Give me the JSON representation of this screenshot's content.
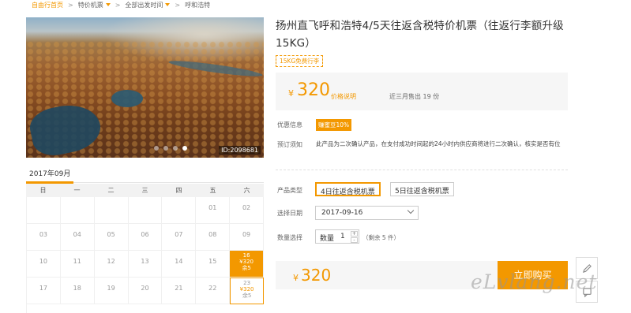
{
  "breadcrumb": {
    "home": "自由行首页",
    "item2": "特价机票",
    "item3": "全部出发时间",
    "current": "呼和浩特",
    "separator": ">"
  },
  "photo": {
    "id_label": "ID:2098681",
    "slide_count": 4,
    "active_slide": 4
  },
  "calendar": {
    "month": "2017年09月",
    "weekdays": [
      "日",
      "一",
      "二",
      "三",
      "四",
      "五",
      "六"
    ],
    "rows": [
      [
        "",
        "",
        "",
        "",
        "",
        "01",
        "02"
      ],
      [
        "03",
        "04",
        "05",
        "06",
        "07",
        "08",
        "09"
      ],
      [
        "10",
        "11",
        "12",
        "13",
        "14",
        "15",
        "16"
      ],
      [
        "17",
        "18",
        "19",
        "20",
        "21",
        "22",
        "23"
      ]
    ],
    "sel_day": "16",
    "sel_price": "¥320",
    "sel_stock": "余5",
    "avail_day": "23",
    "avail_price": "¥320",
    "avail_stock": "余5"
  },
  "product": {
    "title": "扬州直飞呼和浩特4/5天往返含税特价机票（往返行李额升级15KG）",
    "tag": "15KG免费行李",
    "currency": "¥",
    "price": "320",
    "price_explain": "价格说明",
    "sold": "近三月售出 19 份"
  },
  "info": {
    "promo_label": "优惠信息",
    "promo_badge": "赚蜜豆10%",
    "notice_label": "预订须知",
    "notice_text": "此产品为二次确认产品，在支付成功时间起的24小时内供应商将进行二次确认，核实是否有位"
  },
  "options": {
    "type_label": "产品类型",
    "types": [
      "4日往返含税机票",
      "5日往返含税机票"
    ],
    "date_label": "选择日期",
    "date_value": "2017-09-16",
    "qty_label": "数量选择",
    "qty_inner_label": "数量",
    "qty_value": "1",
    "qty_up": "+",
    "qty_down": "-",
    "remain": "（剩余 5 件）"
  },
  "buy": {
    "currency": "¥",
    "price": "320",
    "button": "立即购买"
  },
  "watermark": "eLvlang.net",
  "colors": {
    "accent": "#f39800"
  }
}
